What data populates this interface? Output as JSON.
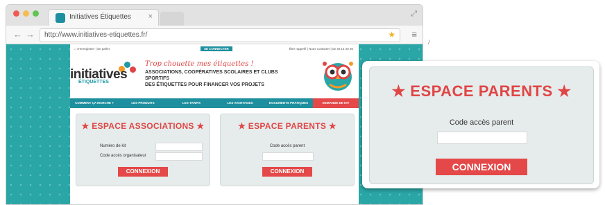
{
  "browser": {
    "tab_title": "Initiatives Étiquettes",
    "tab_close": "×",
    "url": "http://www.initiatives-etiquettes.fr/",
    "back_icon": "←",
    "forward_icon": "→",
    "star_icon": "★",
    "menu_icon": "≡",
    "expand_icon": "⤢"
  },
  "site": {
    "topline_left": "⌂ S'enregistrer | Se parler",
    "connect_label": "SE CONNECTER",
    "topline_right": "Être rappelé | Nous contacter | 02 40 14 20 30",
    "logo_main": "initiatives",
    "logo_sub": "ÉTIQUETTES",
    "tagline": "Trop chouette mes étiquettes !",
    "headline_1": "ASSOCIATIONS, COOPÉRATIVES SCOLAIRES ET CLUBS SPORTIFS",
    "headline_2": "DES ÉTIQUETTES POUR FINANCER VOS PROJETS",
    "nav": [
      "COMMENT ÇA MARCHE ?",
      "LES PRODUITS",
      "LES TARIFS",
      "LES AVANTAGES",
      "DOCUMENTS PRATIQUES",
      "DEMANDE DE KIT"
    ]
  },
  "assoc_panel": {
    "title": "★ ESPACE ASSOCIATIONS ★",
    "kit_label": "Numéro de kit",
    "code_label": "Code accès organisateur",
    "button": "CONNEXION"
  },
  "parents_panel": {
    "title": "★ ESPACE PARENTS ★",
    "code_label": "Code accès parent",
    "button": "CONNEXION"
  },
  "callout": {
    "title": "★ ESPACE PARENTS ★",
    "code_label": "Code accès parent",
    "button": "CONNEXION"
  },
  "colors": {
    "teal": "#1e8f9e",
    "red": "#e44848",
    "panel_bg": "#e6eceb"
  }
}
